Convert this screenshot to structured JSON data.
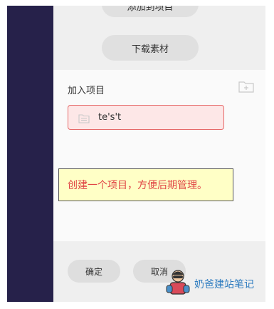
{
  "top_button_partial": "添加到项目",
  "download_button": "下载素材",
  "add_section": {
    "label": "加入项目"
  },
  "project": {
    "name": "te's't"
  },
  "footer": {
    "confirm": "确定",
    "cancel": "取消"
  },
  "tooltip": {
    "text": "创建一个项目，方便后期管理。"
  },
  "watermark": {
    "text": "奶爸建站笔记"
  },
  "colors": {
    "sidebar": "#26214a",
    "project_border": "#e66a6a",
    "project_bg": "#fde7e7",
    "tooltip_bg": "#ffffc6",
    "tooltip_text": "#e04444",
    "watermark_text": "#2e7cc0"
  },
  "icons": [
    "folder-icon",
    "add-folder-icon",
    "mascot-icon"
  ]
}
